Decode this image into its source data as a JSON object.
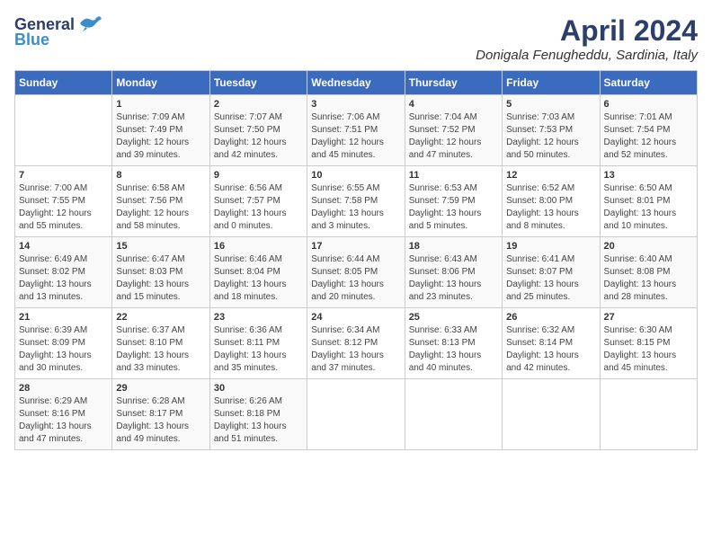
{
  "logo": {
    "general": "General",
    "blue": "Blue"
  },
  "title": "April 2024",
  "location": "Donigala Fenugheddu, Sardinia, Italy",
  "days_header": [
    "Sunday",
    "Monday",
    "Tuesday",
    "Wednesday",
    "Thursday",
    "Friday",
    "Saturday"
  ],
  "weeks": [
    [
      {
        "day": "",
        "info": ""
      },
      {
        "day": "1",
        "info": "Sunrise: 7:09 AM\nSunset: 7:49 PM\nDaylight: 12 hours\nand 39 minutes."
      },
      {
        "day": "2",
        "info": "Sunrise: 7:07 AM\nSunset: 7:50 PM\nDaylight: 12 hours\nand 42 minutes."
      },
      {
        "day": "3",
        "info": "Sunrise: 7:06 AM\nSunset: 7:51 PM\nDaylight: 12 hours\nand 45 minutes."
      },
      {
        "day": "4",
        "info": "Sunrise: 7:04 AM\nSunset: 7:52 PM\nDaylight: 12 hours\nand 47 minutes."
      },
      {
        "day": "5",
        "info": "Sunrise: 7:03 AM\nSunset: 7:53 PM\nDaylight: 12 hours\nand 50 minutes."
      },
      {
        "day": "6",
        "info": "Sunrise: 7:01 AM\nSunset: 7:54 PM\nDaylight: 12 hours\nand 52 minutes."
      }
    ],
    [
      {
        "day": "7",
        "info": "Sunrise: 7:00 AM\nSunset: 7:55 PM\nDaylight: 12 hours\nand 55 minutes."
      },
      {
        "day": "8",
        "info": "Sunrise: 6:58 AM\nSunset: 7:56 PM\nDaylight: 12 hours\nand 58 minutes."
      },
      {
        "day": "9",
        "info": "Sunrise: 6:56 AM\nSunset: 7:57 PM\nDaylight: 13 hours\nand 0 minutes."
      },
      {
        "day": "10",
        "info": "Sunrise: 6:55 AM\nSunset: 7:58 PM\nDaylight: 13 hours\nand 3 minutes."
      },
      {
        "day": "11",
        "info": "Sunrise: 6:53 AM\nSunset: 7:59 PM\nDaylight: 13 hours\nand 5 minutes."
      },
      {
        "day": "12",
        "info": "Sunrise: 6:52 AM\nSunset: 8:00 PM\nDaylight: 13 hours\nand 8 minutes."
      },
      {
        "day": "13",
        "info": "Sunrise: 6:50 AM\nSunset: 8:01 PM\nDaylight: 13 hours\nand 10 minutes."
      }
    ],
    [
      {
        "day": "14",
        "info": "Sunrise: 6:49 AM\nSunset: 8:02 PM\nDaylight: 13 hours\nand 13 minutes."
      },
      {
        "day": "15",
        "info": "Sunrise: 6:47 AM\nSunset: 8:03 PM\nDaylight: 13 hours\nand 15 minutes."
      },
      {
        "day": "16",
        "info": "Sunrise: 6:46 AM\nSunset: 8:04 PM\nDaylight: 13 hours\nand 18 minutes."
      },
      {
        "day": "17",
        "info": "Sunrise: 6:44 AM\nSunset: 8:05 PM\nDaylight: 13 hours\nand 20 minutes."
      },
      {
        "day": "18",
        "info": "Sunrise: 6:43 AM\nSunset: 8:06 PM\nDaylight: 13 hours\nand 23 minutes."
      },
      {
        "day": "19",
        "info": "Sunrise: 6:41 AM\nSunset: 8:07 PM\nDaylight: 13 hours\nand 25 minutes."
      },
      {
        "day": "20",
        "info": "Sunrise: 6:40 AM\nSunset: 8:08 PM\nDaylight: 13 hours\nand 28 minutes."
      }
    ],
    [
      {
        "day": "21",
        "info": "Sunrise: 6:39 AM\nSunset: 8:09 PM\nDaylight: 13 hours\nand 30 minutes."
      },
      {
        "day": "22",
        "info": "Sunrise: 6:37 AM\nSunset: 8:10 PM\nDaylight: 13 hours\nand 33 minutes."
      },
      {
        "day": "23",
        "info": "Sunrise: 6:36 AM\nSunset: 8:11 PM\nDaylight: 13 hours\nand 35 minutes."
      },
      {
        "day": "24",
        "info": "Sunrise: 6:34 AM\nSunset: 8:12 PM\nDaylight: 13 hours\nand 37 minutes."
      },
      {
        "day": "25",
        "info": "Sunrise: 6:33 AM\nSunset: 8:13 PM\nDaylight: 13 hours\nand 40 minutes."
      },
      {
        "day": "26",
        "info": "Sunrise: 6:32 AM\nSunset: 8:14 PM\nDaylight: 13 hours\nand 42 minutes."
      },
      {
        "day": "27",
        "info": "Sunrise: 6:30 AM\nSunset: 8:15 PM\nDaylight: 13 hours\nand 45 minutes."
      }
    ],
    [
      {
        "day": "28",
        "info": "Sunrise: 6:29 AM\nSunset: 8:16 PM\nDaylight: 13 hours\nand 47 minutes."
      },
      {
        "day": "29",
        "info": "Sunrise: 6:28 AM\nSunset: 8:17 PM\nDaylight: 13 hours\nand 49 minutes."
      },
      {
        "day": "30",
        "info": "Sunrise: 6:26 AM\nSunset: 8:18 PM\nDaylight: 13 hours\nand 51 minutes."
      },
      {
        "day": "",
        "info": ""
      },
      {
        "day": "",
        "info": ""
      },
      {
        "day": "",
        "info": ""
      },
      {
        "day": "",
        "info": ""
      }
    ]
  ]
}
